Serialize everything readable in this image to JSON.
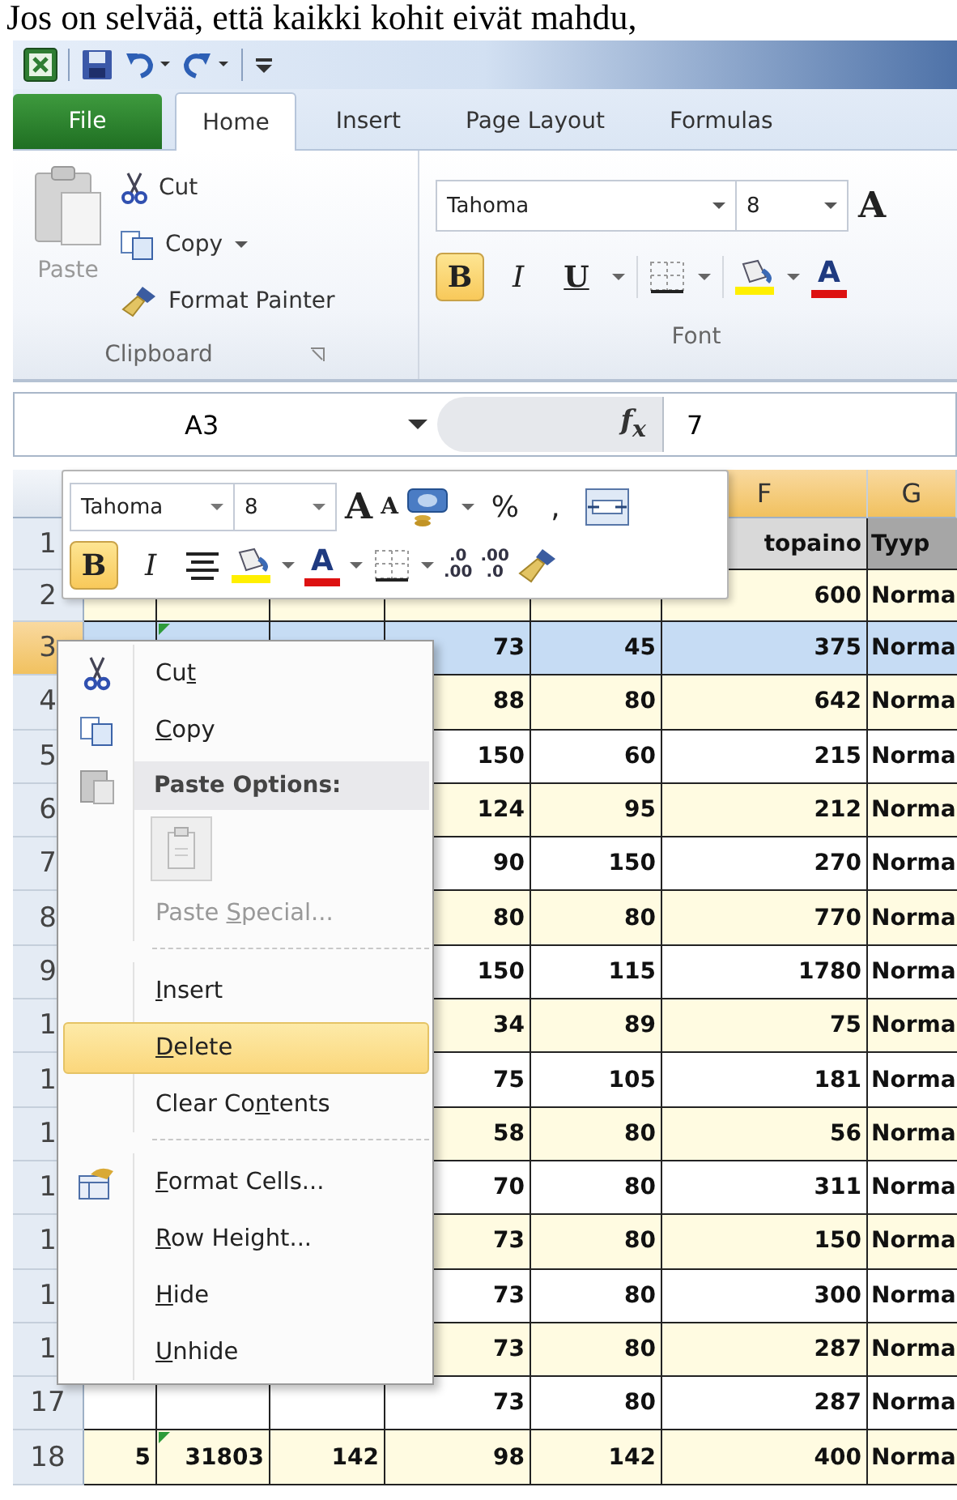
{
  "caption": "Jos on selvää, että kaikki kohit eivät mahdu,",
  "ribbon": {
    "tabs": [
      {
        "label": "File",
        "kind": "file",
        "selected": false
      },
      {
        "label": "Home",
        "kind": "tab",
        "selected": true
      },
      {
        "label": "Insert",
        "kind": "tab",
        "selected": false
      },
      {
        "label": "Page Layout",
        "kind": "tab",
        "selected": false
      },
      {
        "label": "Formulas",
        "kind": "tab",
        "selected": false
      }
    ],
    "clipboard": {
      "paste": {
        "label": "Paste",
        "disabled": true
      },
      "cut": "Cut",
      "copy": "Copy",
      "format_painter": "Format Painter",
      "group_label": "Clipboard"
    },
    "font": {
      "name": "Tahoma",
      "size": "8",
      "grow": "A",
      "bold": {
        "label": "B",
        "on": true
      },
      "italic": "I",
      "underline": "U",
      "font_color": "A",
      "group_label": "Font"
    }
  },
  "formula_bar": {
    "name_box": "A3",
    "fx": "f$_{x}$",
    "value": "7"
  },
  "mini_toolbar": {
    "font": "Tahoma",
    "size": "8",
    "grow": "A",
    "shrink": "A",
    "percent": "%",
    "comma": ",",
    "bold": {
      "label": "B",
      "on": true
    },
    "italic": "I",
    "font_color": "A",
    "increase_decimal": [
      ".0",
      ".00"
    ],
    "decrease_decimal": [
      ".00",
      ".0"
    ]
  },
  "sheet": {
    "columns": [
      null,
      null,
      null,
      null,
      null,
      {
        "label": "F",
        "selected": true
      },
      {
        "label": "G",
        "selected": true
      }
    ],
    "rows": [
      {
        "number": "1",
        "kind": "heading",
        "selected": false,
        "cells": [
          null,
          null,
          null,
          null,
          null,
          "topaino",
          "Tyyp"
        ]
      },
      {
        "number": "2",
        "kind": "data",
        "selected": false,
        "color": "#fffbe1",
        "cells": [
          null,
          null,
          null,
          null,
          null,
          "600",
          "Norma"
        ]
      },
      {
        "number": "3",
        "kind": "data",
        "selected": true,
        "green_mark": true,
        "cells": [
          null,
          null,
          null,
          "73",
          "45",
          "375",
          "Norma"
        ]
      },
      {
        "number": "4",
        "kind": "data",
        "selected": false,
        "color": "#fffbe1",
        "cells": [
          null,
          null,
          null,
          "88",
          "80",
          "642",
          "Norma"
        ]
      },
      {
        "number": "5",
        "kind": "data",
        "selected": false,
        "color": "#ffffff",
        "cells": [
          null,
          null,
          null,
          "150",
          "60",
          "215",
          "Norma"
        ]
      },
      {
        "number": "6",
        "kind": "data",
        "selected": false,
        "color": "#fffbe1",
        "cells": [
          null,
          null,
          null,
          "124",
          "95",
          "212",
          "Norma"
        ]
      },
      {
        "number": "7",
        "kind": "data",
        "selected": false,
        "color": "#ffffff",
        "cells": [
          null,
          null,
          null,
          "90",
          "150",
          "270",
          "Norma"
        ]
      },
      {
        "number": "8",
        "kind": "data",
        "selected": false,
        "color": "#fffbe1",
        "cells": [
          null,
          null,
          null,
          "80",
          "80",
          "770",
          "Norma"
        ]
      },
      {
        "number": "9",
        "kind": "data",
        "selected": false,
        "color": "#ffffff",
        "cells": [
          null,
          null,
          null,
          "150",
          "115",
          "1780",
          "Norma"
        ]
      },
      {
        "number": "1",
        "kind": "data",
        "selected": false,
        "color": "#fffbe1",
        "cells": [
          null,
          null,
          null,
          "34",
          "89",
          "75",
          "Norma"
        ]
      },
      {
        "number": "1",
        "kind": "data",
        "selected": false,
        "color": "#ffffff",
        "cells": [
          null,
          null,
          null,
          "75",
          "105",
          "181",
          "Norma"
        ]
      },
      {
        "number": "1",
        "kind": "data",
        "selected": false,
        "color": "#fffbe1",
        "cells": [
          null,
          null,
          null,
          "58",
          "80",
          "56",
          "Norma"
        ]
      },
      {
        "number": "1",
        "kind": "data",
        "selected": false,
        "color": "#ffffff",
        "cells": [
          null,
          null,
          null,
          "70",
          "80",
          "311",
          "Norma"
        ]
      },
      {
        "number": "1",
        "kind": "data",
        "selected": false,
        "color": "#fffbe1",
        "cells": [
          null,
          null,
          null,
          "73",
          "80",
          "150",
          "Norma"
        ]
      },
      {
        "number": "1",
        "kind": "data",
        "selected": false,
        "color": "#ffffff",
        "cells": [
          null,
          null,
          null,
          "73",
          "80",
          "300",
          "Norma"
        ]
      },
      {
        "number": "1",
        "kind": "data",
        "selected": false,
        "color": "#fffbe1",
        "cells": [
          null,
          null,
          null,
          "73",
          "80",
          "287",
          "Norma"
        ]
      },
      {
        "number": "17",
        "kind": "data",
        "selected": false,
        "color": "#ffffff",
        "cells": [
          null,
          null,
          null,
          "73",
          "80",
          "287",
          "Norma"
        ]
      },
      {
        "number": "18",
        "kind": "data",
        "selected": false,
        "color": "#fffbe1",
        "green_mark": true,
        "cells": [
          "5",
          "31803",
          "142",
          "98",
          "142",
          "400",
          "Norma"
        ]
      }
    ]
  },
  "context_menu": {
    "items": [
      {
        "kind": "item",
        "pre": "Cu",
        "key": "t",
        "disabled": false,
        "selected": false
      },
      {
        "kind": "item",
        "key": "C",
        "post": "opy",
        "disabled": false,
        "selected": false
      },
      {
        "kind": "heading",
        "label": "Paste Options:"
      },
      {
        "kind": "paste-button"
      },
      {
        "kind": "item",
        "pre": "Paste ",
        "key": "S",
        "post": "pecial...",
        "disabled": true,
        "selected": false
      },
      {
        "kind": "separator"
      },
      {
        "kind": "item",
        "key": "I",
        "post": "nsert",
        "disabled": false,
        "selected": false
      },
      {
        "kind": "item",
        "key": "D",
        "post": "elete",
        "disabled": false,
        "selected": true
      },
      {
        "kind": "item",
        "pre": "Clear Co",
        "key": "n",
        "post": "tents",
        "disabled": false,
        "selected": false
      },
      {
        "kind": "separator"
      },
      {
        "kind": "item",
        "key": "F",
        "post": "ormat Cells...",
        "disabled": false,
        "selected": false
      },
      {
        "kind": "item",
        "key": "R",
        "post": "ow Height...",
        "disabled": false,
        "selected": false
      },
      {
        "kind": "item",
        "key": "H",
        "post": "ide",
        "disabled": false,
        "selected": false
      },
      {
        "kind": "item",
        "key": "U",
        "post": "nhide",
        "disabled": false,
        "selected": false
      }
    ]
  }
}
